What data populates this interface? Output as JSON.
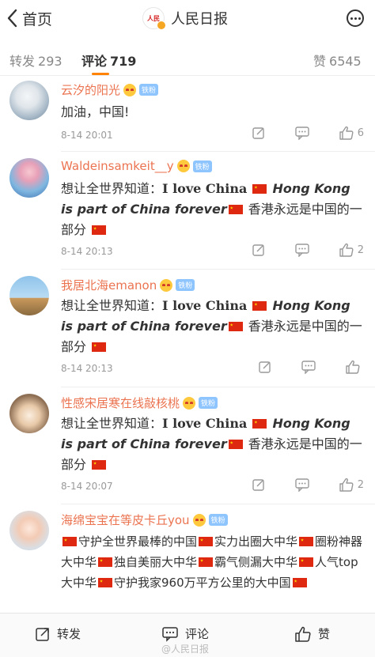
{
  "header": {
    "back_label": "首页",
    "logo_text": "人民日报",
    "title": "人民日报"
  },
  "tabs": {
    "repost_label": "转发",
    "repost_count": "293",
    "comment_label": "评论",
    "comment_count": "719",
    "like_label": "赞",
    "like_count": "6545",
    "accent": "#ff8200"
  },
  "comments": [
    {
      "username": "云汐的阳光",
      "badge": "铁粉",
      "text": "加油，中国!",
      "time": "8-14 20:01",
      "likes": "6"
    },
    {
      "username": "Waldeinsamkeit__y",
      "badge": "铁粉",
      "text_a": "想让全世界知道：",
      "text_b": "I love China",
      "text_c": "Hong Kong is part of China forever",
      "text_d": "香港永远是中国的一部分",
      "time": "8-14 20:13",
      "likes": "2"
    },
    {
      "username": "我居北海emanon",
      "badge": "铁粉",
      "text_a": "想让全世界知道：",
      "text_b": "I love China",
      "text_c": "Hong Kong is part of China forever",
      "text_d": "香港永远是中国的一部分",
      "time": "8-14 20:13",
      "likes": ""
    },
    {
      "username": "性感宋居寒在线敲核桃",
      "badge": "铁粉",
      "text_a": "想让全世界知道：",
      "text_b": "I love China",
      "text_c": "Hong Kong is part of China forever",
      "text_d": "香港永远是中国的一部分",
      "time": "8-14 20:07",
      "likes": "2"
    },
    {
      "username": "海绵宝宝在等皮卡丘you",
      "badge": "铁粉",
      "text_1": "守护全世界最棒的中国",
      "text_2": "实力出圈大中华",
      "text_3": "圈粉神器大中华",
      "text_4": "独自美丽大中华",
      "text_5": "霸气侧漏大中华",
      "text_6": "人气top大中华",
      "text_7": "守护我家960万平方公里的大中国"
    }
  ],
  "bottom_bar": {
    "repost_label": "转发",
    "comment_label": "评论",
    "like_label": "赞",
    "watermark": "@人民日报"
  },
  "icons": [
    "chevron-left-icon",
    "more-icon",
    "edit-icon",
    "comment-icon",
    "like-icon",
    "flag-icon",
    "verified-icon"
  ],
  "colors": {
    "username": "#eb7350",
    "badge": "#8ec5ff",
    "accent": "#ff8200"
  }
}
